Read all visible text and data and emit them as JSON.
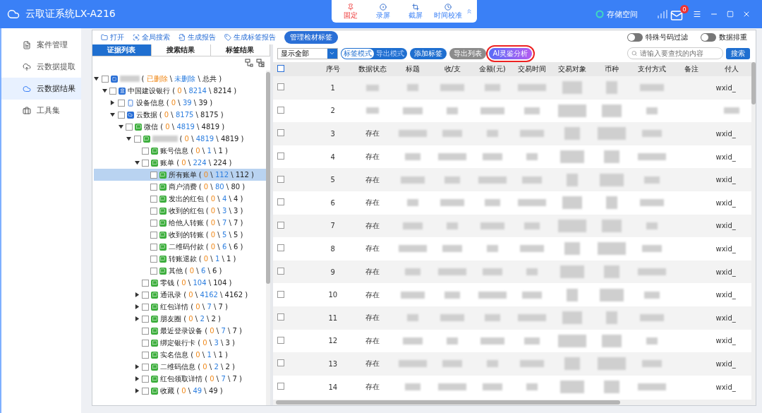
{
  "window": {
    "title": "云取证系统LX-A216",
    "storage": "存储空间",
    "mail_badge": "0"
  },
  "capture_toolbar": [
    {
      "label": "固定",
      "selected": true,
      "kind": "pin"
    },
    {
      "label": "录屏",
      "selected": false,
      "kind": "record"
    },
    {
      "label": "截屏",
      "selected": false,
      "kind": "crop"
    },
    {
      "label": "时间校准",
      "selected": false,
      "kind": "clock"
    }
  ],
  "sidebar": {
    "items": [
      {
        "label": "案件管理",
        "selected": false,
        "kind": "case"
      },
      {
        "label": "云数据提取",
        "selected": false,
        "kind": "upload"
      },
      {
        "label": "云数据结果",
        "selected": true,
        "kind": "cloud"
      },
      {
        "label": "工具集",
        "selected": false,
        "kind": "toolbox"
      }
    ]
  },
  "toolbar": [
    {
      "label": "打开",
      "kind": "folder"
    },
    {
      "label": "全局搜索",
      "kind": "search"
    },
    {
      "label": "生成报告",
      "kind": "report"
    },
    {
      "label": "生成标签报告",
      "kind": "tag"
    },
    {
      "label": "管理检材标签",
      "kind": "pill"
    }
  ],
  "toggles": [
    {
      "label": "特殊号码过滤",
      "on": false
    },
    {
      "label": "数据排重",
      "on": false
    }
  ],
  "tabs": [
    {
      "label": "证据列表",
      "selected": true
    },
    {
      "label": "搜索结果",
      "selected": false
    },
    {
      "label": "标签结果",
      "selected": false
    }
  ],
  "tree": {
    "count_marks": [
      "(",
      "\\",
      "\\",
      ")"
    ],
    "nodes": [
      {
        "kind": "root",
        "blurred": true,
        "deleted": "已删除",
        "undeleted": "未删除",
        "total": "总共",
        "expanded": true,
        "checked": false,
        "selected": false,
        "children": [
          {
            "kind": "bank",
            "label": "中国建设银行",
            "deleted": "0",
            "undeleted": "8214",
            "total": "8214",
            "expanded": true,
            "checked": false,
            "selected": false,
            "children": [
              {
                "kind": "phone",
                "label": "设备信息",
                "deleted": "0",
                "undeleted": "39",
                "total": "39",
                "expanded": false,
                "checked": false,
                "selected": false
              },
              {
                "kind": "cloud",
                "label": "云数据",
                "deleted": "0",
                "undeleted": "8175",
                "total": "8175",
                "expanded": true,
                "checked": false,
                "selected": false,
                "children": [
                  {
                    "kind": "item",
                    "label": "微信",
                    "deleted": "0",
                    "undeleted": "4819",
                    "total": "4819",
                    "expanded": true,
                    "checked": false,
                    "selected": false,
                    "children": [
                      {
                        "kind": "item",
                        "blurred": true,
                        "deleted": "0",
                        "undeleted": "4819",
                        "total": "4819",
                        "expanded": true,
                        "checked": false,
                        "selected": false,
                        "children": [
                          {
                            "kind": "item",
                            "label": "账号信息",
                            "deleted": "0",
                            "undeleted": "1",
                            "total": "1",
                            "checked": false,
                            "selected": false
                          },
                          {
                            "kind": "item",
                            "label": "账单",
                            "deleted": "0",
                            "undeleted": "224",
                            "total": "224",
                            "expanded": true,
                            "checked": false,
                            "selected": false,
                            "children": [
                              {
                                "kind": "item",
                                "label": "所有账单",
                                "deleted": "0",
                                "undeleted": "112",
                                "total": "112",
                                "checked": false,
                                "selected": true
                              },
                              {
                                "kind": "item",
                                "label": "商户消费",
                                "deleted": "0",
                                "undeleted": "80",
                                "total": "80",
                                "checked": false,
                                "selected": false
                              },
                              {
                                "kind": "item",
                                "label": "发出的红包",
                                "deleted": "0",
                                "undeleted": "4",
                                "total": "4",
                                "checked": false,
                                "selected": false
                              },
                              {
                                "kind": "item",
                                "label": "收到的红包",
                                "deleted": "0",
                                "undeleted": "3",
                                "total": "3",
                                "checked": false,
                                "selected": false
                              },
                              {
                                "kind": "item",
                                "label": "给他人转账",
                                "deleted": "0",
                                "undeleted": "7",
                                "total": "7",
                                "checked": false,
                                "selected": false
                              },
                              {
                                "kind": "item",
                                "label": "收到的转账",
                                "deleted": "0",
                                "undeleted": "5",
                                "total": "5",
                                "checked": false,
                                "selected": false
                              },
                              {
                                "kind": "item",
                                "label": "二维码付款",
                                "deleted": "0",
                                "undeleted": "6",
                                "total": "6",
                                "checked": false,
                                "selected": false
                              },
                              {
                                "kind": "item",
                                "label": "转账退款",
                                "deleted": "0",
                                "undeleted": "1",
                                "total": "1",
                                "checked": false,
                                "selected": false
                              },
                              {
                                "kind": "item",
                                "label": "其他",
                                "deleted": "0",
                                "undeleted": "6",
                                "total": "6",
                                "checked": false,
                                "selected": false
                              }
                            ]
                          },
                          {
                            "kind": "item",
                            "label": "零钱",
                            "deleted": "0",
                            "undeleted": "104",
                            "total": "104",
                            "checked": false,
                            "selected": false
                          },
                          {
                            "kind": "item",
                            "label": "通讯录",
                            "deleted": "0",
                            "undeleted": "4162",
                            "total": "4162",
                            "expanded": false,
                            "checked": false,
                            "selected": false
                          },
                          {
                            "kind": "item",
                            "label": "红包详情",
                            "deleted": "0",
                            "undeleted": "7",
                            "total": "7",
                            "expanded": false,
                            "checked": false,
                            "selected": false
                          },
                          {
                            "kind": "item",
                            "label": "朋友圈",
                            "deleted": "0",
                            "undeleted": "2",
                            "total": "2",
                            "expanded": false,
                            "checked": false,
                            "selected": false
                          },
                          {
                            "kind": "item",
                            "label": "最近登录设备",
                            "deleted": "0",
                            "undeleted": "7",
                            "total": "7",
                            "checked": false,
                            "selected": false
                          },
                          {
                            "kind": "item",
                            "label": "绑定银行卡",
                            "deleted": "0",
                            "undeleted": "3",
                            "total": "3",
                            "checked": false,
                            "selected": false
                          },
                          {
                            "kind": "item",
                            "label": "实名信息",
                            "deleted": "0",
                            "undeleted": "1",
                            "total": "1",
                            "checked": false,
                            "selected": false
                          },
                          {
                            "kind": "item",
                            "label": "二维码信息",
                            "deleted": "0",
                            "undeleted": "2",
                            "total": "2",
                            "expanded": false,
                            "checked": false,
                            "selected": false
                          },
                          {
                            "kind": "item",
                            "label": "红包领取详情",
                            "deleted": "0",
                            "undeleted": "7",
                            "total": "7",
                            "expanded": false,
                            "checked": false,
                            "selected": false
                          },
                          {
                            "kind": "item",
                            "label": "收藏",
                            "deleted": "0",
                            "undeleted": "49",
                            "total": "49",
                            "expanded": false,
                            "checked": false,
                            "selected": false
                          }
                        ]
                      }
                    ]
                  }
                ]
              }
            ]
          }
        ]
      }
    ]
  },
  "filter": {
    "value": "显示全部",
    "modes": [
      {
        "label": "标签模式",
        "selected": true
      },
      {
        "label": "导出模式",
        "selected": false
      }
    ],
    "buttons": [
      {
        "label": "添加标签",
        "kind": "primary"
      },
      {
        "label": "导出列表",
        "kind": "muted"
      },
      {
        "label": "AI灵鉴分析",
        "kind": "ai"
      }
    ],
    "search_placeholder": "请输入要查找的内容",
    "search_button": "搜索"
  },
  "table": {
    "all_checked": false,
    "columns": [
      "序号",
      "数据状态",
      "标题",
      "收/支",
      "金额(元)",
      "交易时间",
      "交易对象",
      "币种",
      "支付方式",
      "备注",
      "付人"
    ],
    "rows": [
      {
        "index": "1",
        "checked": false,
        "payer": "wxid_"
      },
      {
        "index": "2",
        "checked": false
      },
      {
        "index": "3",
        "checked": false,
        "status": "存在",
        "payer": "wxid_"
      },
      {
        "index": "4",
        "checked": false,
        "status": "存在",
        "payer": "wxid_"
      },
      {
        "index": "5",
        "checked": false,
        "status": "存在",
        "payer": "wxid_"
      },
      {
        "index": "6",
        "checked": false,
        "status": "存在",
        "payer": "wxid_"
      },
      {
        "index": "7",
        "checked": false,
        "status": "存在",
        "payer": "wxid_"
      },
      {
        "index": "8",
        "checked": false,
        "status": "存在",
        "payer": "wxid_"
      },
      {
        "index": "9",
        "checked": false,
        "status": "存在",
        "payer": "wxid_"
      },
      {
        "index": "10",
        "checked": false,
        "status": "存在",
        "payer": "wxid_"
      },
      {
        "index": "11",
        "checked": false,
        "status": "存在",
        "payer": "wxid_"
      },
      {
        "index": "12",
        "checked": false,
        "status": "存在",
        "payer": "wxid_"
      },
      {
        "index": "13",
        "checked": false,
        "status": "存在",
        "payer": "wxid_"
      },
      {
        "index": "14",
        "checked": false,
        "status": "存在",
        "payer": "wxid_"
      }
    ]
  }
}
